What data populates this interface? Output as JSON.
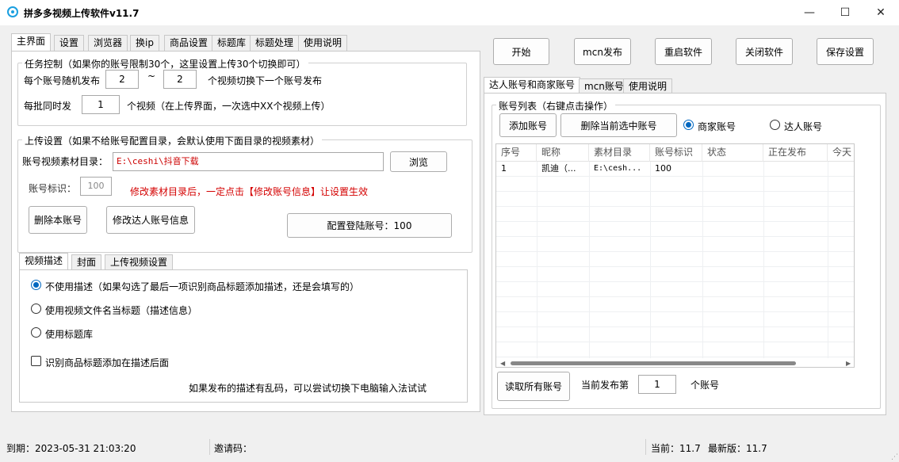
{
  "window": {
    "title": "拼多多视频上传软件v11.7",
    "minimize": "—",
    "maximize": "☐",
    "close": "✕"
  },
  "left_tabs": [
    "主界面",
    "设置",
    "浏览器",
    "换ip",
    "商品设置",
    "标题库",
    "标题处理",
    "使用说明"
  ],
  "task_control": {
    "legend": "任务控制（如果你的账号限制30个，这里设置上传30个切换即可）",
    "random_label": "每个账号随机发布",
    "random_min": "2",
    "tilde": "~",
    "random_max": "2",
    "random_suffix": "个视频切换下一个账号发布",
    "batch_label": "每批同时发",
    "batch_value": "1",
    "batch_suffix": "个视频（在上传界面，一次选中XX个视频上传）"
  },
  "upload_settings": {
    "legend": "上传设置（如果不给账号配置目录，会默认使用下面目录的视频素材）",
    "dir_label": "账号视频素材目录：",
    "dir_value": "E:\\ceshi\\抖音下载",
    "browse": "浏览",
    "id_label": "账号标识：",
    "id_value": "100",
    "warning": "修改素材目录后，一定点击【修改账号信息】让设置生效",
    "delete_btn": "删除本账号",
    "modify_btn": "修改达人账号信息",
    "login_btn": "配置登陆账号：100"
  },
  "desc_tabs": [
    "视频描述",
    "封面",
    "上传视频设置"
  ],
  "desc": {
    "opt1": "不使用描述（如果勾选了最后一项识别商品标题添加描述，还是会填写的）",
    "opt2": "使用视频文件名当标题（描述信息）",
    "opt3": "使用标题库",
    "check": "识别商品标题添加在描述后面",
    "note": "如果发布的描述有乱码，可以尝试切换下电脑输入法试试"
  },
  "top_buttons": [
    "开始",
    "mcn发布",
    "重启软件",
    "关闭软件",
    "保存设置"
  ],
  "right_tabs": [
    "达人账号和商家账号",
    "mcn账号",
    "使用说明"
  ],
  "accounts": {
    "legend": "账号列表（右键点击操作）",
    "add": "添加账号",
    "delete_selected": "删除当前选中账号",
    "radio_merchant": "商家账号",
    "radio_talent": "达人账号",
    "columns": [
      "序号",
      "昵称",
      "素材目录",
      "账号标识",
      "状态",
      "正在发布",
      "今天"
    ],
    "rows": [
      [
        "1",
        "凯迪（...",
        "E:\\cesh...",
        "100",
        "",
        "",
        ""
      ]
    ],
    "read_all": "读取所有账号",
    "current_label": "当前发布第",
    "current_value": "1",
    "current_suffix": "个账号"
  },
  "status": {
    "expire": "到期：2023-05-31 21:03:20",
    "invite": "邀请码：",
    "current": "当前：11.7",
    "latest": "最新版：11.7"
  }
}
